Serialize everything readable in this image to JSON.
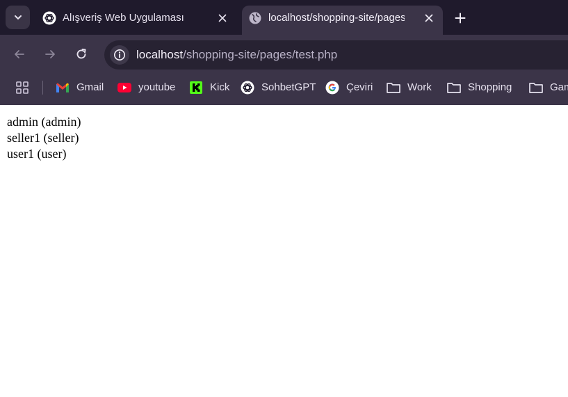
{
  "tabs": [
    {
      "title": "Alışveriş Web Uygulaması",
      "favicon": "openai-icon",
      "active": false
    },
    {
      "title": "localhost/shopping-site/pages/",
      "favicon": "globe-icon",
      "active": true
    }
  ],
  "toolbar": {
    "url_host": "localhost",
    "url_path": "/shopping-site/pages/test.php"
  },
  "bookmarks": [
    {
      "label": "Gmail",
      "icon": "gmail-icon"
    },
    {
      "label": "youtube",
      "icon": "youtube-icon"
    },
    {
      "label": "Kick",
      "icon": "kick-icon"
    },
    {
      "label": "SohbetGPT",
      "icon": "openai-icon"
    },
    {
      "label": "Çeviri",
      "icon": "google-icon"
    },
    {
      "label": "Work",
      "icon": "folder-icon"
    },
    {
      "label": "Shopping",
      "icon": "folder-icon"
    },
    {
      "label": "Gam",
      "icon": "folder-icon"
    }
  ],
  "page": {
    "users": [
      "admin (admin)",
      "seller1 (seller)",
      "user1 (user)"
    ]
  },
  "colors": {
    "tabstrip": "#1f1a2c",
    "toolbar": "#3b3448",
    "omnibox": "#272232",
    "page_background": "#ffffff"
  }
}
